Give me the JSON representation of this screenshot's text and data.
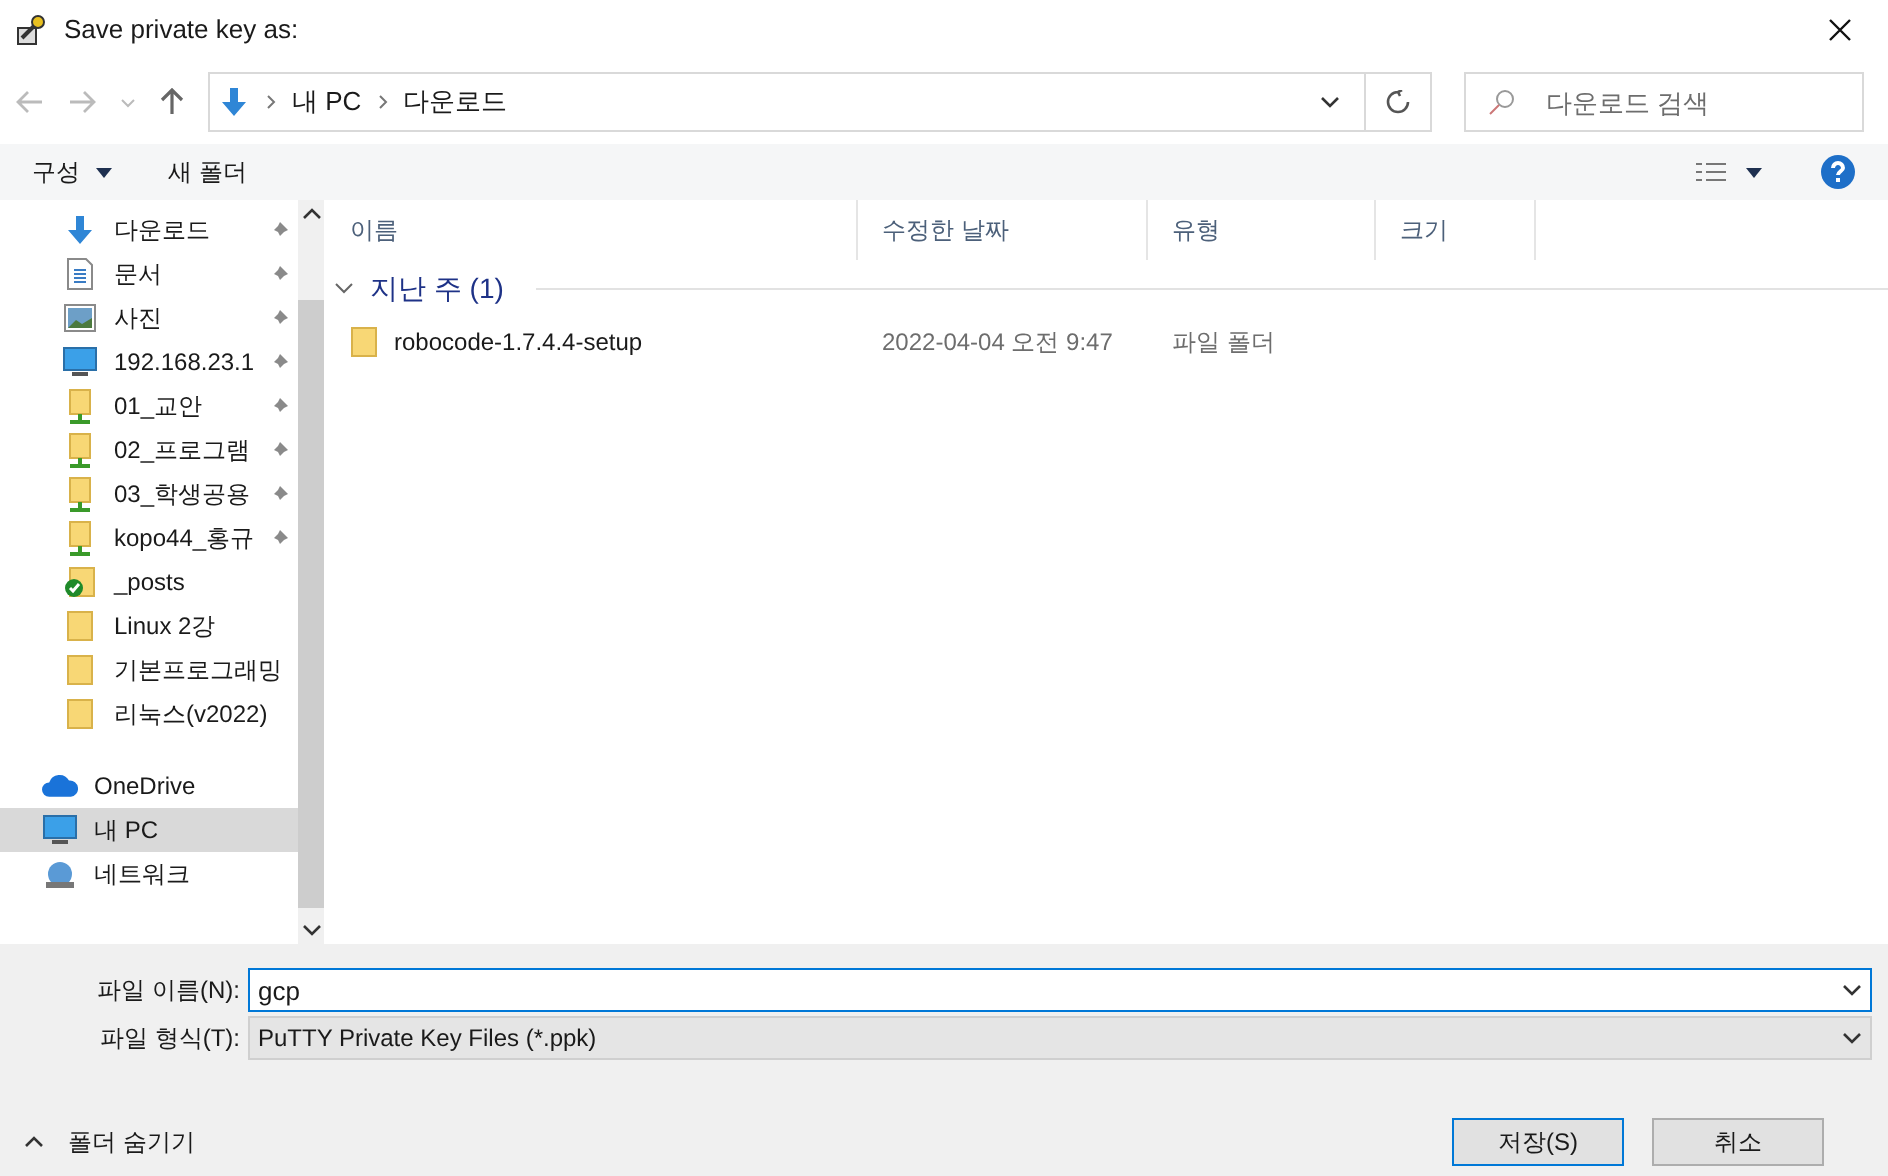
{
  "window": {
    "title": "Save private key as:"
  },
  "address": {
    "crumbs": [
      "내 PC",
      "다운로드"
    ]
  },
  "search": {
    "placeholder": "다운로드 검색"
  },
  "toolbar": {
    "organize": "구성",
    "new_folder": "새 폴더"
  },
  "sidebar": {
    "items": [
      {
        "label": "다운로드",
        "kind": "download",
        "pinned": true,
        "selected": false
      },
      {
        "label": "문서",
        "kind": "document",
        "pinned": true,
        "selected": false
      },
      {
        "label": "사진",
        "kind": "picture",
        "pinned": true,
        "selected": false
      },
      {
        "label": "192.168.23.1",
        "kind": "monitor",
        "pinned": true,
        "selected": false
      },
      {
        "label": "01_교안",
        "kind": "sharedfolder",
        "pinned": true,
        "selected": false
      },
      {
        "label": "02_프로그램",
        "kind": "sharedfolder",
        "pinned": true,
        "selected": false
      },
      {
        "label": "03_학생공용",
        "kind": "sharedfolder",
        "pinned": true,
        "selected": false
      },
      {
        "label": "kopo44_홍규",
        "kind": "sharedfolder",
        "pinned": true,
        "selected": false
      },
      {
        "label": "_posts",
        "kind": "syncfolder",
        "pinned": false,
        "selected": false
      },
      {
        "label": "Linux 2강",
        "kind": "folder",
        "pinned": false,
        "selected": false
      },
      {
        "label": "기본프로그래밍",
        "kind": "folder",
        "pinned": false,
        "selected": false
      },
      {
        "label": "리눅스(v2022)",
        "kind": "folder",
        "pinned": false,
        "selected": false
      },
      {
        "label": "OneDrive",
        "kind": "cloud",
        "pinned": false,
        "selected": false
      },
      {
        "label": "내 PC",
        "kind": "pc",
        "pinned": false,
        "selected": true
      },
      {
        "label": "네트워크",
        "kind": "network",
        "pinned": false,
        "selected": false
      }
    ]
  },
  "table": {
    "columns": [
      "이름",
      "수정한 날짜",
      "유형",
      "크기"
    ],
    "groups": [
      {
        "title": "지난 주 (1)",
        "expanded": true,
        "rows": [
          {
            "name": "robocode-1.7.4.4-setup",
            "modified": "2022-04-04 오전 9:47",
            "type": "파일 폴더"
          }
        ]
      }
    ]
  },
  "filename": {
    "label": "파일 이름(N):",
    "value": "gcp"
  },
  "filetype": {
    "label": "파일 형식(T):",
    "value": "PuTTY Private Key Files (*.ppk)"
  },
  "hide_folders": "폴더 숨기기",
  "buttons": [
    "저장(S)",
    "취소"
  ]
}
